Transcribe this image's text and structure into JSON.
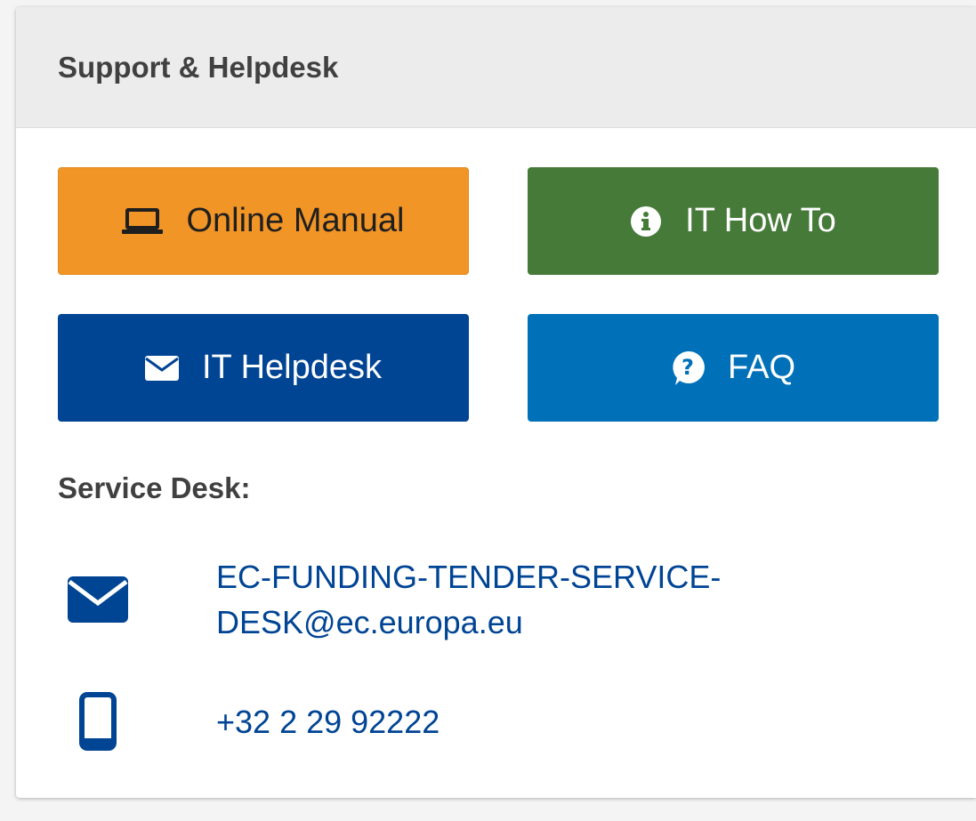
{
  "panel": {
    "title": "Support & Helpdesk"
  },
  "buttons": [
    {
      "label": "Online Manual",
      "icon": "laptop-icon",
      "color": "#f29527"
    },
    {
      "label": "IT How To",
      "icon": "info-circle-icon",
      "color": "#467a39"
    },
    {
      "label": "IT Helpdesk",
      "icon": "envelope-icon",
      "color": "#004494"
    },
    {
      "label": "FAQ",
      "icon": "question-circle-icon",
      "color": "#0071b8"
    }
  ],
  "service_desk": {
    "title": "Service Desk:",
    "email_line1": "EC-FUNDING-TENDER-SERVICE-",
    "email_line2": "DESK@ec.europa.eu",
    "email_icon": "envelope-icon",
    "phone": "+32 2 29 92222",
    "phone_icon": "mobile-phone-icon",
    "link_color": "#004494"
  }
}
